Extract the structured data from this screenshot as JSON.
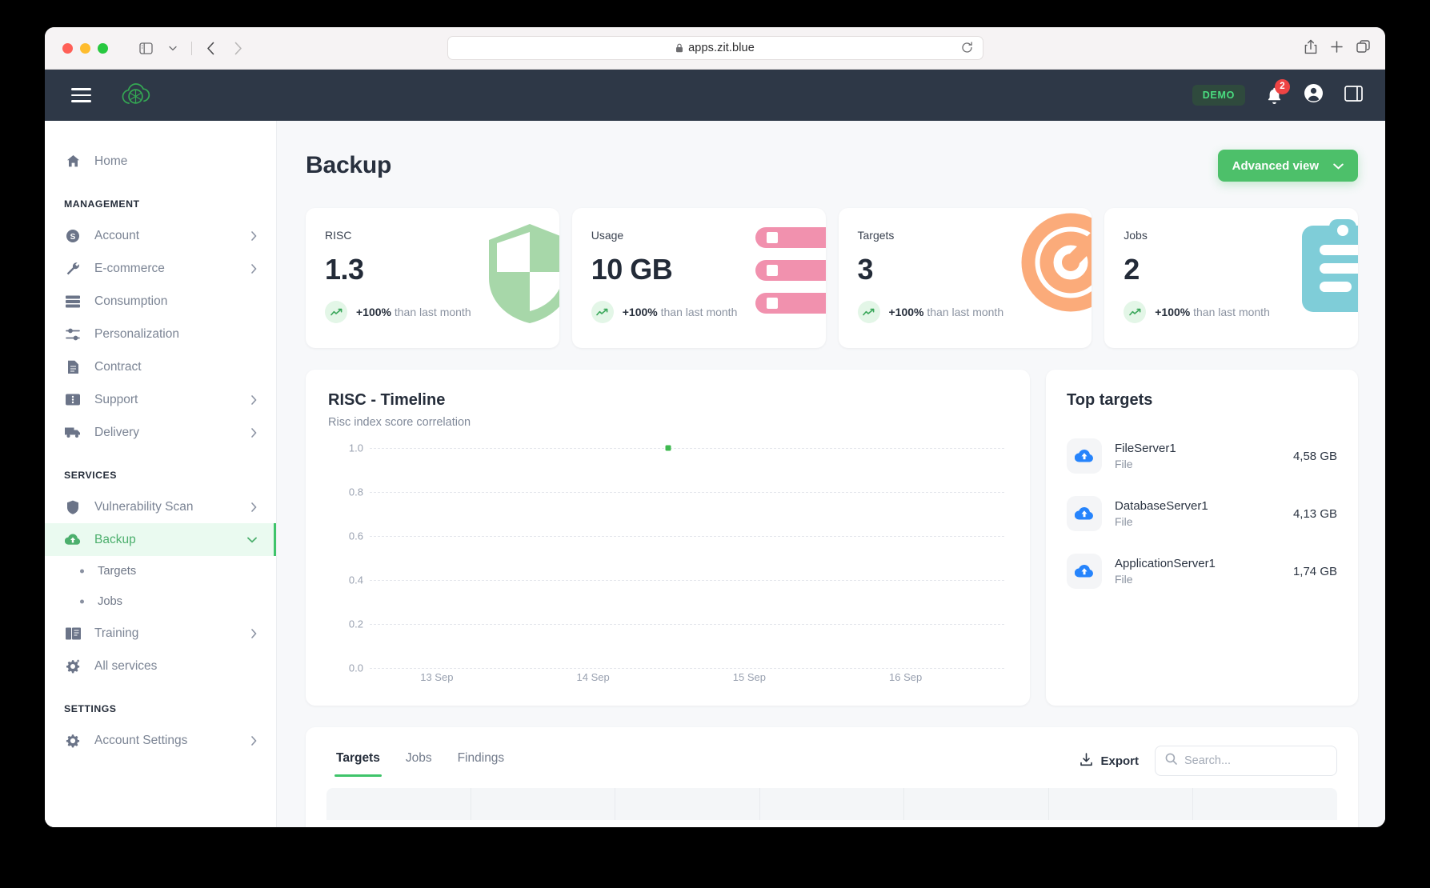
{
  "browser": {
    "url": "apps.zit.blue",
    "lock_icon": "lock-icon",
    "shield_icon": "privacy-shield-icon",
    "reload_icon": "reload-icon",
    "back_icon": "back-arrow-icon",
    "forward_icon": "forward-arrow-icon",
    "sidebar_icon": "sidebar-toggle-icon",
    "share_icon": "share-icon",
    "newtab_icon": "new-tab-icon",
    "tabs_icon": "tab-overview-icon"
  },
  "appbar": {
    "menu_icon": "hamburger-menu-icon",
    "logo_icon": "zit-cloud-logo",
    "demo_label": "DEMO",
    "bell_icon": "notification-bell-icon",
    "bell_count": "2",
    "account_icon": "account-circle-icon",
    "panel_icon": "right-panel-toggle-icon"
  },
  "sidebar": {
    "home": {
      "label": "Home",
      "icon": "home-icon"
    },
    "sections": [
      {
        "title": "MANAGEMENT",
        "items": [
          {
            "label": "Account",
            "icon": "dollar-circle-icon",
            "chevron": true
          },
          {
            "label": "E-commerce",
            "icon": "wrench-icon",
            "chevron": true
          },
          {
            "label": "Consumption",
            "icon": "list-rows-icon",
            "chevron": false
          },
          {
            "label": "Personalization",
            "icon": "sliders-icon",
            "chevron": false
          },
          {
            "label": "Contract",
            "icon": "document-icon",
            "chevron": false
          },
          {
            "label": "Support",
            "icon": "ticket-icon",
            "chevron": true
          },
          {
            "label": "Delivery",
            "icon": "truck-icon",
            "chevron": true
          }
        ]
      },
      {
        "title": "SERVICES",
        "items": [
          {
            "label": "Vulnerability Scan",
            "icon": "shield-icon",
            "chevron": true
          },
          {
            "label": "Backup",
            "icon": "cloud-upload-icon",
            "chevron": true,
            "active": true,
            "expanded": true,
            "children": [
              {
                "label": "Targets"
              },
              {
                "label": "Jobs"
              }
            ]
          },
          {
            "label": "Training",
            "icon": "book-icon",
            "chevron": true
          },
          {
            "label": "All services",
            "icon": "gear-plus-icon",
            "chevron": false
          }
        ]
      },
      {
        "title": "SETTINGS",
        "items": [
          {
            "label": "Account Settings",
            "icon": "gear-icon",
            "chevron": true
          }
        ]
      }
    ]
  },
  "page": {
    "title": "Backup",
    "advanced_view_label": "Advanced view",
    "advanced_view_chevron": "chevron-down-icon"
  },
  "stats": [
    {
      "label": "RISC",
      "value": "1.3",
      "delta": "+100%",
      "delta_suffix": "than last month",
      "icon": "shield-icon",
      "color": "#a7d7a9"
    },
    {
      "label": "Usage",
      "value": "10 GB",
      "delta": "+100%",
      "delta_suffix": "than last month",
      "icon": "storage-bars-icon",
      "color": "#f191ae"
    },
    {
      "label": "Targets",
      "value": "3",
      "delta": "+100%",
      "delta_suffix": "than last month",
      "icon": "target-icon",
      "color": "#fbab7a"
    },
    {
      "label": "Jobs",
      "value": "2",
      "delta": "+100%",
      "delta_suffix": "than last month",
      "icon": "clipboard-icon",
      "color": "#7fcdd8"
    }
  ],
  "chart_data": {
    "type": "scatter",
    "title": "RISC - Timeline",
    "subtitle": "Risc index score correlation",
    "xlabel": "",
    "ylabel": "",
    "categories": [
      "13 Sep",
      "14 Sep",
      "15 Sep",
      "16 Sep"
    ],
    "yticks": [
      "0.0",
      "0.2",
      "0.4",
      "0.6",
      "0.8",
      "1.0"
    ],
    "ylim": [
      0,
      1
    ],
    "grid": true,
    "legend": false,
    "series": [
      {
        "name": "RISC",
        "color": "#3fb950",
        "points": [
          {
            "x": "14.3 Sep",
            "y": 1.0
          }
        ]
      }
    ]
  },
  "top_targets": {
    "title": "Top targets",
    "rows": [
      {
        "name": "FileServer1",
        "type": "File",
        "size": "4,58 GB",
        "icon": "cloud-upload-icon"
      },
      {
        "name": "DatabaseServer1",
        "type": "File",
        "size": "4,13 GB",
        "icon": "cloud-upload-icon"
      },
      {
        "name": "ApplicationServer1",
        "type": "File",
        "size": "1,74 GB",
        "icon": "cloud-upload-icon"
      }
    ]
  },
  "table_panel": {
    "tabs": [
      {
        "label": "Targets",
        "active": true
      },
      {
        "label": "Jobs",
        "active": false
      },
      {
        "label": "Findings",
        "active": false
      }
    ],
    "export_label": "Export",
    "export_icon": "download-icon",
    "search_icon": "search-icon",
    "search_placeholder": "Search...",
    "search_value": ""
  },
  "colors": {
    "accent_green": "#3fc46a",
    "appbar": "#2e3847",
    "page_bg": "#f7f8fa"
  }
}
